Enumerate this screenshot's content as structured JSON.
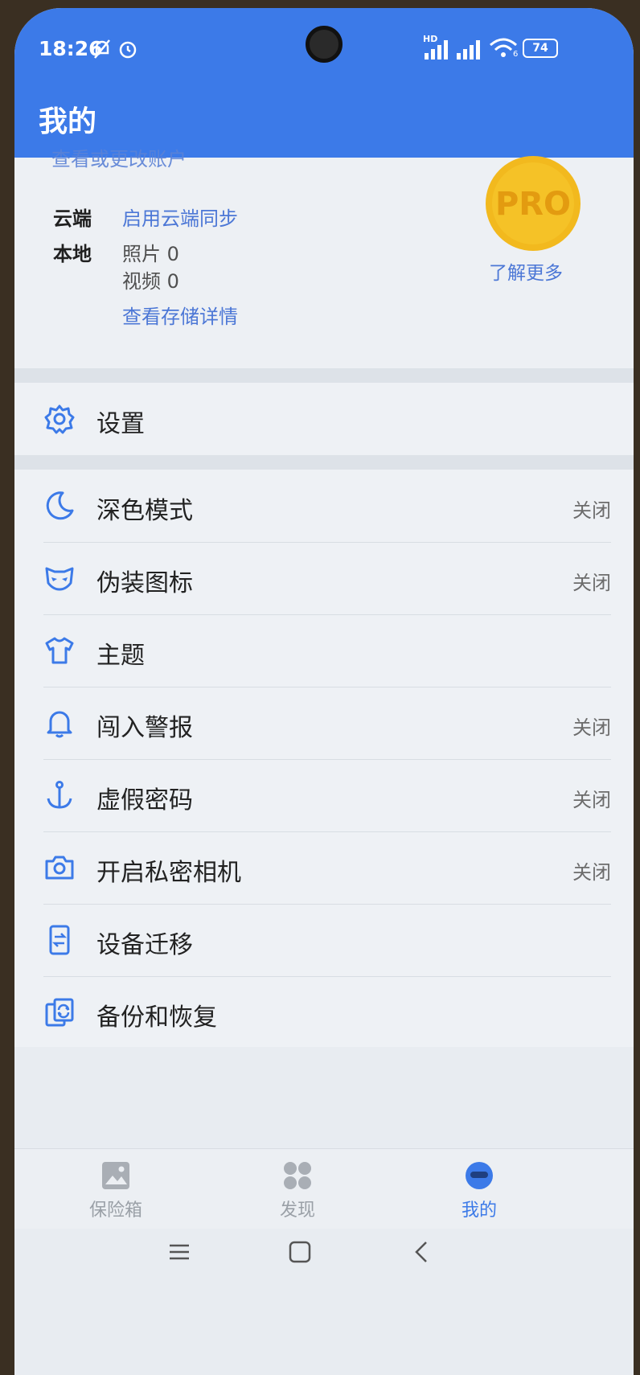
{
  "status_bar": {
    "time": "18:26",
    "battery": "74",
    "network_badge": "HD",
    "wifi_badge": "6"
  },
  "header": {
    "title": "我的"
  },
  "account": {
    "change_account_link": "查看或更改账户",
    "cloud_label": "云端",
    "cloud_value": "启用云端同步",
    "local_label": "本地",
    "photos": "照片 0",
    "videos": "视频 0",
    "storage_link": "查看存储详情",
    "pro_badge": "PRO",
    "learn_more": "了解更多"
  },
  "settings_item": {
    "label": "设置",
    "icon": "gear-icon"
  },
  "menu": {
    "items": [
      {
        "label": "深色模式",
        "state": "关闭",
        "icon": "moon-icon"
      },
      {
        "label": "伪装图标",
        "state": "关闭",
        "icon": "mask-icon"
      },
      {
        "label": "主题",
        "state": "",
        "icon": "shirt-icon"
      },
      {
        "label": "闯入警报",
        "state": "关闭",
        "icon": "bell-icon"
      },
      {
        "label": "虚假密码",
        "state": "关闭",
        "icon": "anchor-icon"
      },
      {
        "label": "开启私密相机",
        "state": "关闭",
        "icon": "camera-icon"
      },
      {
        "label": "设备迁移",
        "state": "",
        "icon": "device-transfer-icon"
      },
      {
        "label": "备份和恢复",
        "state": "",
        "icon": "backup-icon"
      }
    ]
  },
  "tabs": [
    {
      "label": "保险箱",
      "icon": "image-icon",
      "active": false
    },
    {
      "label": "发现",
      "icon": "grid-icon",
      "active": false
    },
    {
      "label": "我的",
      "icon": "avatar-icon",
      "active": true
    }
  ],
  "colors": {
    "primary": "#3c7ae8",
    "link": "#4c77d6",
    "pro_gold": "#f5c227"
  }
}
